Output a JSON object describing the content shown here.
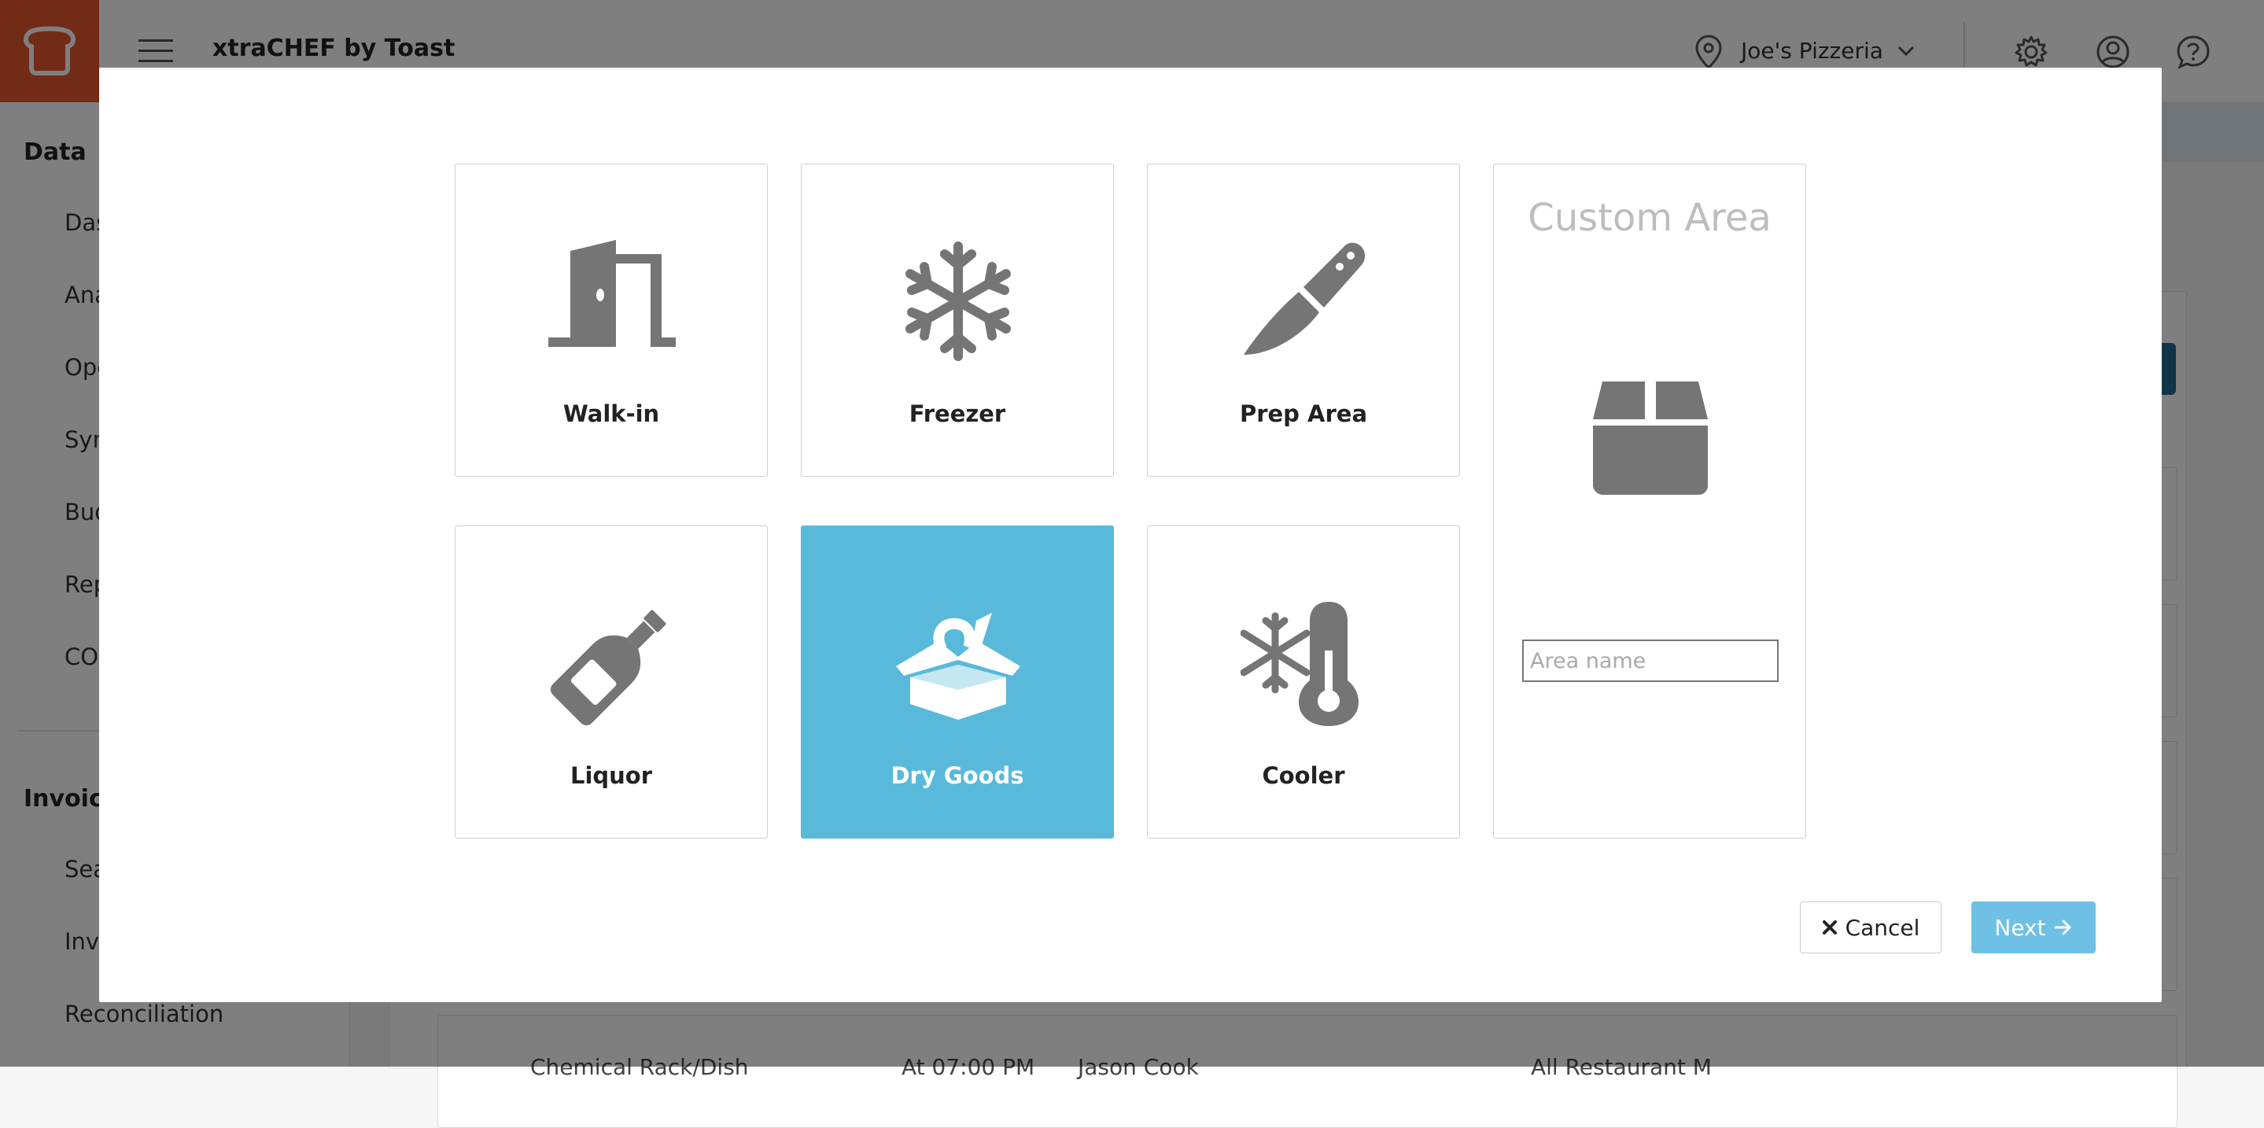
{
  "header": {
    "app_title": "xtraCHEF by Toast",
    "location_name": "Joe's Pizzeria"
  },
  "sidebar": {
    "section_data": "Data",
    "data_items": [
      "Das",
      "Ana",
      "Ope",
      "Syn",
      "Bud",
      "Rep",
      "COG"
    ],
    "section_invoices": "Invoice",
    "invoice_items": [
      "Sea",
      "Inv",
      "Reconciliation"
    ]
  },
  "background": {
    "row_texts": [
      "Chemical Rack/Dish",
      "At 07:00 PM",
      "Jason Cook",
      "All Restaurant M"
    ]
  },
  "modal": {
    "tiles": [
      {
        "label": "Walk-in",
        "icon": "door-icon"
      },
      {
        "label": "Freezer",
        "icon": "snowflake-icon"
      },
      {
        "label": "Prep Area",
        "icon": "knife-icon"
      },
      {
        "label": "Liquor",
        "icon": "bottle-icon"
      },
      {
        "label": "Dry Goods",
        "icon": "open-box-icon",
        "selected": true
      },
      {
        "label": "Cooler",
        "icon": "thermometer-snowflake-icon"
      }
    ],
    "custom_area": {
      "title": "Custom Area",
      "input_value": "",
      "placeholder": "Area name"
    },
    "cancel_label": "Cancel",
    "next_label": "Next"
  },
  "colors": {
    "brand_orange": "#e4572e",
    "selected_tile": "#59b9da",
    "next_button": "#6ec1e4",
    "icon_gray": "#757575"
  }
}
